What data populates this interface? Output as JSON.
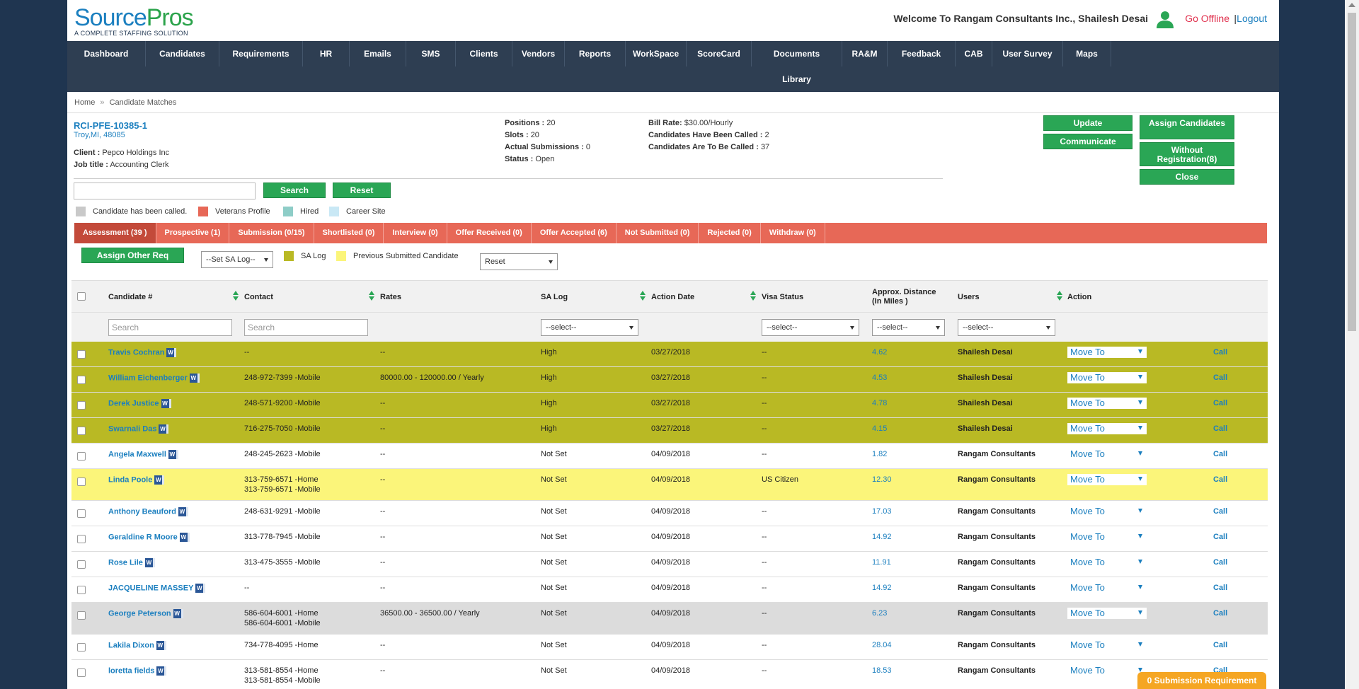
{
  "logo": {
    "brand_a": "Source",
    "brand_b": "Pros",
    "tagline": "A COMPLETE STAFFING SOLUTION"
  },
  "header": {
    "welcome": "Welcome To Rangam Consultants Inc., Shailesh Desai",
    "go_offline": "Go Offline",
    "separator": "|",
    "logout": "Logout"
  },
  "nav": [
    "Dashboard",
    "Candidates",
    "Requirements",
    "HR",
    "Emails",
    "SMS",
    "Clients",
    "Vendors",
    "Reports",
    "WorkSpace",
    "ScoreCard",
    "Documents Library",
    "RA&M",
    "Feedback",
    "CAB",
    "User Survey",
    "Maps"
  ],
  "breadcrumb": {
    "home": "Home",
    "sep": "»",
    "current": "Candidate Matches"
  },
  "requirement": {
    "id": "RCI-PFE-10385-1",
    "location": "Troy,MI, 48085",
    "client_label": "Client :",
    "client": "Pepco Holdings Inc",
    "job_title_label": "Job title :",
    "job_title": "Accounting Clerk",
    "positions_label": "Positions :",
    "positions": "20",
    "slots_label": "Slots :",
    "slots": "20",
    "actual_label": "Actual Submissions :",
    "actual": "0",
    "status_label": "Status :",
    "status": "Open",
    "bill_rate_label": "Bill Rate:",
    "bill_rate": "$30.00/Hourly",
    "called_label": "Candidates Have Been Called :",
    "called": "2",
    "to_call_label": "Candidates Are To Be Called :",
    "to_call": "37"
  },
  "buttons": {
    "update": "Update",
    "communicate": "Communicate",
    "assign": "Assign Candidates",
    "without_reg": "Without Registration(8)",
    "close": "Close",
    "search": "Search",
    "reset": "Reset",
    "assign_other": "Assign Other Req"
  },
  "legend": {
    "called": "Candidate has been called.",
    "veterans": "Veterans Profile",
    "hired": "Hired",
    "career": "Career Site",
    "sa_log": "SA Log",
    "prev_submitted": "Previous Submitted Candidate"
  },
  "colors": {
    "called": "#c9c9c9",
    "veterans": "#e76857",
    "hired": "#8ecdc7",
    "career": "#c9e8f5",
    "sa_log": "#b9b924",
    "prev_submitted": "#fbf57a"
  },
  "tabs": [
    "Assessment (39 )",
    "Prospective (1)",
    "Submission (0/15)",
    "Shortlisted (0)",
    "Interview (0)",
    "Offer Received (0)",
    "Offer Accepted (6)",
    "Not Submitted (0)",
    "Rejected (0)",
    "Withdraw (0)"
  ],
  "tools": {
    "sa_log_select": "--Set SA Log--",
    "reset_select": "Reset"
  },
  "table": {
    "headers": {
      "candidate": "Candidate #",
      "contact": "Contact",
      "rates": "Rates",
      "sa_log": "SA Log",
      "action_date": "Action Date",
      "visa": "Visa Status",
      "distance": "Approx. Distance (In Miles )",
      "users": "Users",
      "action": "Action"
    },
    "filters": {
      "candidate_placeholder": "Search",
      "contact_placeholder": "Search",
      "sa_log": "--select--",
      "visa": "--select--",
      "distance": "--select--",
      "users": "--select--"
    },
    "move_to": "Move To",
    "call": "Call",
    "rows": [
      {
        "name": "Travis Cochran",
        "contact": [
          "--"
        ],
        "rates": "--",
        "sa": "High",
        "date": "03/27/2018",
        "visa": "--",
        "dist": "4.62",
        "user": "Shailesh Desai",
        "bg": "sa"
      },
      {
        "name": "William Eichenberger",
        "contact": [
          "248-972-7399 -Mobile"
        ],
        "rates": "80000.00 - 120000.00 / Yearly",
        "sa": "High",
        "date": "03/27/2018",
        "visa": "--",
        "dist": "4.53",
        "user": "Shailesh Desai",
        "bg": "sa"
      },
      {
        "name": "Derek Justice",
        "contact": [
          "248-571-9200 -Mobile"
        ],
        "rates": "--",
        "sa": "High",
        "date": "03/27/2018",
        "visa": "--",
        "dist": "4.78",
        "user": "Shailesh Desai",
        "bg": "sa"
      },
      {
        "name": "Swarnali Das",
        "contact": [
          "716-275-7050 -Mobile"
        ],
        "rates": "--",
        "sa": "High",
        "date": "03/27/2018",
        "visa": "--",
        "dist": "4.15",
        "user": "Shailesh Desai",
        "bg": "sa"
      },
      {
        "name": "Angela Maxwell",
        "contact": [
          "248-245-2623 -Mobile"
        ],
        "rates": "--",
        "sa": "Not Set",
        "date": "04/09/2018",
        "visa": "--",
        "dist": "1.82",
        "user": "Rangam Consultants",
        "bg": "white"
      },
      {
        "name": "Linda Poole",
        "contact": [
          "313-759-6571 -Home",
          "313-759-6571 -Mobile"
        ],
        "rates": "--",
        "sa": "Not Set",
        "date": "04/09/2018",
        "visa": "US Citizen",
        "dist": "12.30",
        "user": "Rangam Consultants",
        "bg": "prev"
      },
      {
        "name": "Anthony Beauford",
        "contact": [
          "248-631-9291 -Mobile"
        ],
        "rates": "--",
        "sa": "Not Set",
        "date": "04/09/2018",
        "visa": "--",
        "dist": "17.03",
        "user": "Rangam Consultants",
        "bg": "white"
      },
      {
        "name": "Geraldine R Moore",
        "contact": [
          "313-778-7945 -Mobile"
        ],
        "rates": "--",
        "sa": "Not Set",
        "date": "04/09/2018",
        "visa": "--",
        "dist": "14.92",
        "user": "Rangam Consultants",
        "bg": "white"
      },
      {
        "name": "Rose Lile",
        "contact": [
          "313-475-3555 -Mobile"
        ],
        "rates": "--",
        "sa": "Not Set",
        "date": "04/09/2018",
        "visa": "--",
        "dist": "11.91",
        "user": "Rangam Consultants",
        "bg": "white"
      },
      {
        "name": "JACQUELINE MASSEY",
        "contact": [
          "--"
        ],
        "rates": "--",
        "sa": "Not Set",
        "date": "04/09/2018",
        "visa": "--",
        "dist": "14.92",
        "user": "Rangam Consultants",
        "bg": "white"
      },
      {
        "name": "George Peterson",
        "contact": [
          "586-604-6001 -Home",
          "586-604-6001 -Mobile"
        ],
        "rates": "36500.00 - 36500.00 / Yearly",
        "sa": "Not Set",
        "date": "04/09/2018",
        "visa": "--",
        "dist": "6.23",
        "user": "Rangam Consultants",
        "bg": "called"
      },
      {
        "name": "Lakila Dixon",
        "contact": [
          "734-778-4095 -Home"
        ],
        "rates": "--",
        "sa": "Not Set",
        "date": "04/09/2018",
        "visa": "--",
        "dist": "28.04",
        "user": "Rangam Consultants",
        "bg": "white"
      },
      {
        "name": "loretta fields",
        "contact": [
          "313-581-8554 -Home",
          "313-581-8554 -Mobile"
        ],
        "rates": "--",
        "sa": "Not Set",
        "date": "04/09/2018",
        "visa": "--",
        "dist": "18.53",
        "user": "Rangam Consultants",
        "bg": "white"
      }
    ]
  },
  "footer": {
    "submission_req": "0 Submission Requirement"
  }
}
